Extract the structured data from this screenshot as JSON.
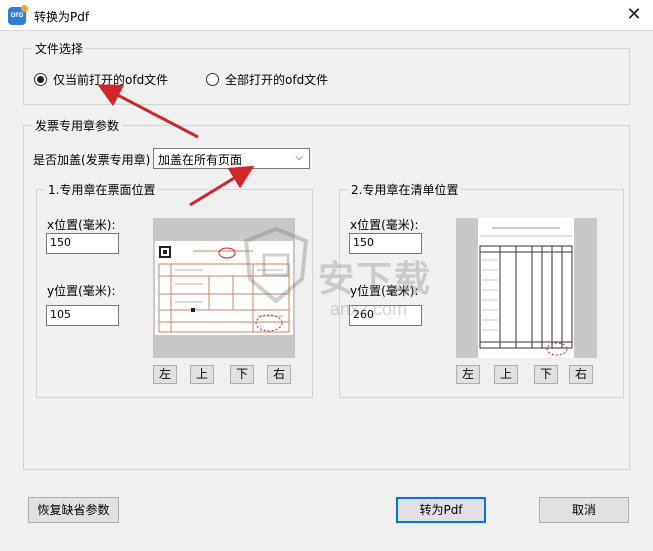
{
  "window": {
    "title": "转换为Pdf",
    "icon_text": "OFD",
    "close_glyph": "✕"
  },
  "file_select": {
    "legend": "文件选择",
    "option_current": "仅当前打开的ofd文件",
    "option_all": "全部打开的ofd文件",
    "selected": "current"
  },
  "stamp_params": {
    "legend": "发票专用章参数",
    "apply_label": "是否加盖(发票专用章)",
    "apply_value": "加盖在所有页面",
    "chevron": "⌵"
  },
  "invoice_position": {
    "legend": "1.专用章在票面位置",
    "x_label": "x位置(毫米):",
    "x_value": "150",
    "y_label": "y位置(毫米):",
    "y_value": "105",
    "btn_left": "左",
    "btn_up": "上",
    "btn_down": "下",
    "btn_right": "右"
  },
  "list_position": {
    "legend": "2.专用章在清单位置",
    "x_label": "x位置(毫米):",
    "x_value": "150",
    "y_label": "y位置(毫米):",
    "y_value": "260",
    "btn_left": "左",
    "btn_up": "上",
    "btn_down": "下",
    "btn_right": "右"
  },
  "footer": {
    "restore_label": "恢复缺省参数",
    "convert_label": "转为Pdf",
    "cancel_label": "取消"
  },
  "watermark": {
    "text": "安下载",
    "sub": "anxz.com"
  },
  "colors": {
    "annotation_red": "#d0252a",
    "invoice_line": "#c9855f",
    "focus_blue": "#0078d7"
  }
}
